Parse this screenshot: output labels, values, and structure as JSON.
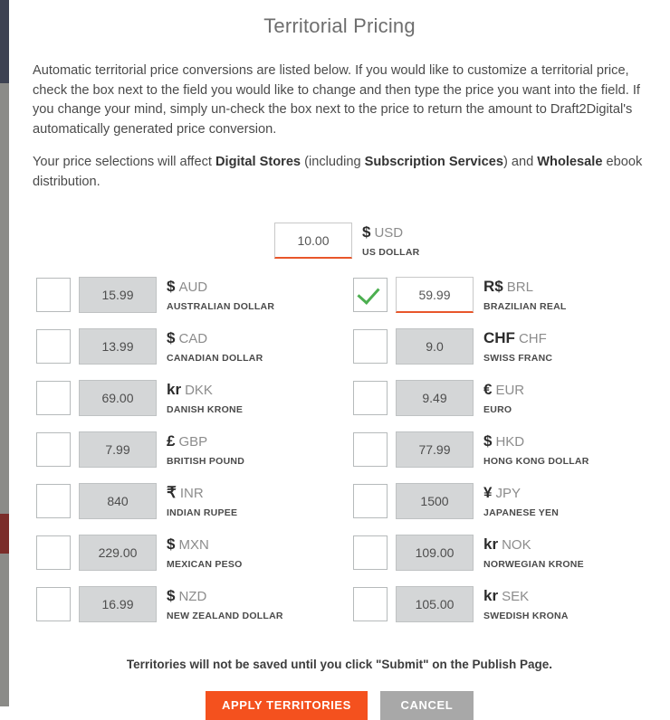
{
  "background": {
    "nav_color": "#3d4252",
    "page_color": "#8b8b88",
    "accent_block_color": "#7b2d2a"
  },
  "modal": {
    "title": "Territorial Pricing",
    "intro_paragraph": "Automatic territorial price conversions are listed below. If you would like to customize a territorial price, check the box next to the field you would like to change and then type the price you want into the field. If you change your mind, simply un-check the box next to the price to return the amount to Draft2Digital's automatically generated price conversion.",
    "affect_paragraph": {
      "part1": "Your price selections will affect ",
      "bold1": "Digital Stores",
      "part2": " (including ",
      "bold2": "Subscription Services",
      "part3": ") and ",
      "bold3": "Wholesale",
      "part4": " ebook distribution."
    },
    "footer_note": "Territories will not be saved until you click \"Submit\" on the Publish Page.",
    "buttons": {
      "apply_label": "APPLY TERRITORIES",
      "apply_color": "#f4511e",
      "cancel_label": "CANCEL",
      "cancel_color": "#a8a8a8"
    },
    "colors": {
      "active_field_underline": "#e8562a",
      "disabled_field_bg": "#d4d6d7",
      "checkmark": "#4caf50"
    }
  },
  "base_price": {
    "value": "10.00",
    "symbol": "$",
    "code": "USD",
    "name": "US DOLLAR",
    "enabled": true
  },
  "currencies_left": [
    {
      "value": "15.99",
      "symbol": "$",
      "code": "AUD",
      "name": "AUSTRALIAN DOLLAR",
      "checked": false
    },
    {
      "value": "13.99",
      "symbol": "$",
      "code": "CAD",
      "name": "CANADIAN DOLLAR",
      "checked": false
    },
    {
      "value": "69.00",
      "symbol": "kr",
      "code": "DKK",
      "name": "DANISH KRONE",
      "checked": false
    },
    {
      "value": "7.99",
      "symbol": "£",
      "code": "GBP",
      "name": "BRITISH POUND",
      "checked": false
    },
    {
      "value": "840",
      "symbol": "₹",
      "code": "INR",
      "name": "INDIAN RUPEE",
      "checked": false
    },
    {
      "value": "229.00",
      "symbol": "$",
      "code": "MXN",
      "name": "MEXICAN PESO",
      "checked": false
    },
    {
      "value": "16.99",
      "symbol": "$",
      "code": "NZD",
      "name": "NEW ZEALAND DOLLAR",
      "checked": false
    }
  ],
  "currencies_right": [
    {
      "value": "59.99",
      "symbol": "R$",
      "code": "BRL",
      "name": "BRAZILIAN REAL",
      "checked": true
    },
    {
      "value": "9.0",
      "symbol": "CHF",
      "code": "CHF",
      "name": "SWISS FRANC",
      "checked": false
    },
    {
      "value": "9.49",
      "symbol": "€",
      "code": "EUR",
      "name": "EURO",
      "checked": false
    },
    {
      "value": "77.99",
      "symbol": "$",
      "code": "HKD",
      "name": "HONG KONG DOLLAR",
      "checked": false
    },
    {
      "value": "1500",
      "symbol": "¥",
      "code": "JPY",
      "name": "JAPANESE YEN",
      "checked": false
    },
    {
      "value": "109.00",
      "symbol": "kr",
      "code": "NOK",
      "name": "NORWEGIAN KRONE",
      "checked": false
    },
    {
      "value": "105.00",
      "symbol": "kr",
      "code": "SEK",
      "name": "SWEDISH KRONA",
      "checked": false
    }
  ]
}
